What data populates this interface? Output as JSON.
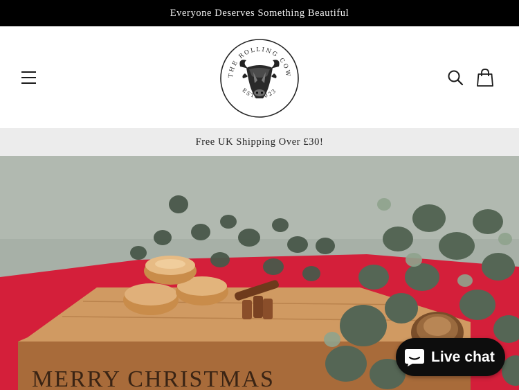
{
  "announcement": {
    "text": "Everyone Deserves Something Beautiful"
  },
  "header": {
    "logo": {
      "arc_top": "THE ROLLING COW",
      "arc_bottom": "EST. 2023"
    },
    "icons": {
      "menu": "hamburger-menu-icon",
      "search": "search-icon",
      "cart": "shopping-bag-icon"
    }
  },
  "shipping_bar": {
    "text": "Free UK Shipping Over £30!"
  },
  "hero": {
    "board_text": "MERRY CHRISTMAS",
    "colors": {
      "wall": "#a7b0a7",
      "cloth": "#d41f3a",
      "board": "#c58a52",
      "leaf": "#49584a"
    }
  },
  "chat": {
    "label": "Live chat",
    "icon": "chat-bubble-icon"
  }
}
